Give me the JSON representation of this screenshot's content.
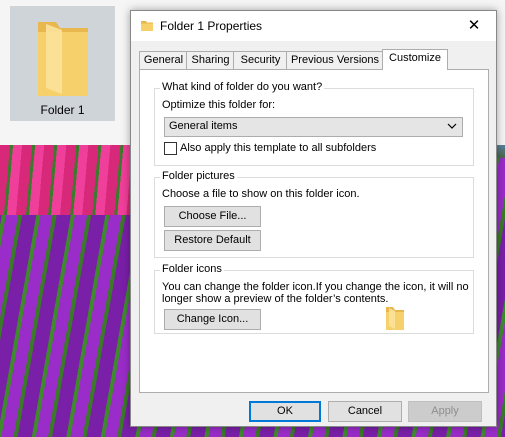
{
  "desktop": {
    "icon_label": "Folder 1"
  },
  "dialog": {
    "title": "Folder 1 Properties",
    "close_glyph": "✕",
    "tabs": [
      {
        "label": "General"
      },
      {
        "label": "Sharing"
      },
      {
        "label": "Security"
      },
      {
        "label": "Previous Versions"
      },
      {
        "label": "Customize"
      }
    ],
    "active_tab": "Customize"
  },
  "customize": {
    "kind_group": {
      "legend": "What kind of folder do you want?",
      "optimize_label": "Optimize this folder for:",
      "selected_option": "General items",
      "apply_subfolders_label": "Also apply this template to all subfolders",
      "apply_subfolders_checked": false
    },
    "pictures_group": {
      "legend": "Folder pictures",
      "description": "Choose a file to show on this folder icon.",
      "choose_file_label": "Choose File...",
      "restore_default_label": "Restore Default"
    },
    "icons_group": {
      "legend": "Folder icons",
      "description_line1": "You can change the folder icon.If you change the icon, it will no",
      "description_line2": "longer show a preview of the folder’s contents.",
      "change_icon_label": "Change Icon..."
    }
  },
  "footer": {
    "ok_label": "OK",
    "cancel_label": "Cancel",
    "apply_label": "Apply"
  },
  "colors": {
    "folder_yellow": "#f6d06a",
    "accent_blue": "#0078d7"
  }
}
